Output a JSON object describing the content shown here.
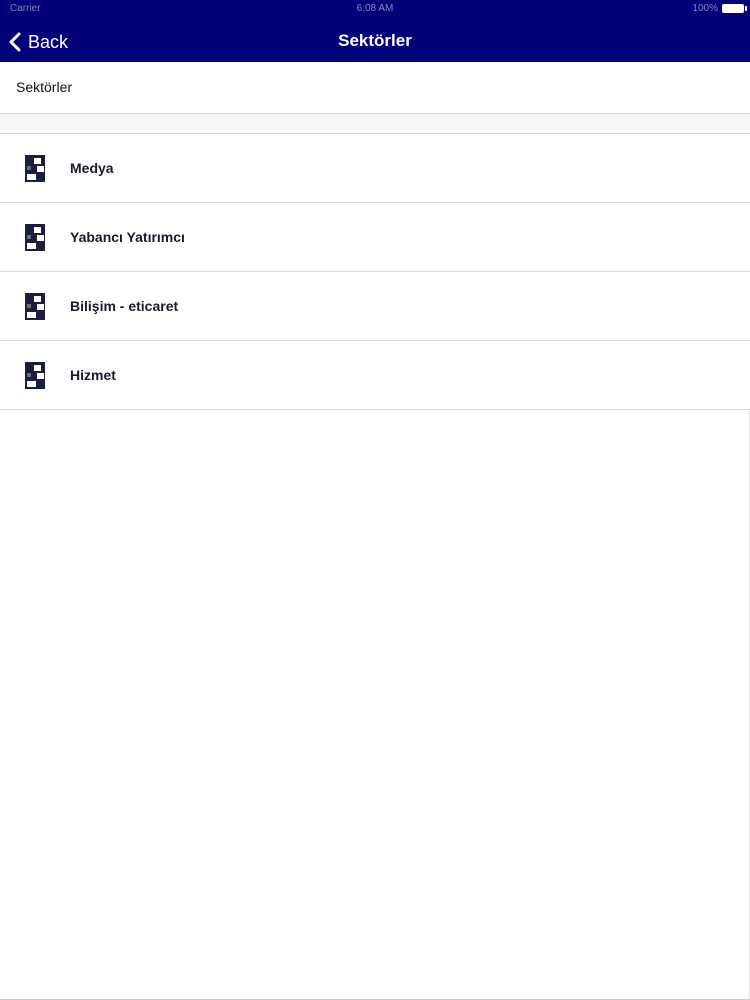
{
  "status_bar": {
    "carrier": "Carrier",
    "time": "6:08 AM",
    "battery": "100%"
  },
  "nav": {
    "back_label": "Back",
    "title": "Sektörler"
  },
  "section_header": {
    "label": "Sektörler"
  },
  "sectors": [
    {
      "label": "Medya",
      "icon": "building-icon"
    },
    {
      "label": "Yabancı Yatırımcı",
      "icon": "building-icon"
    },
    {
      "label": "Bilişim - eticaret",
      "icon": "building-icon"
    },
    {
      "label": "Hizmet",
      "icon": "building-icon"
    }
  ],
  "colors": {
    "nav_background": "#01017a",
    "icon_color": "#1b1d3e",
    "divider": "#d9d9d9"
  }
}
